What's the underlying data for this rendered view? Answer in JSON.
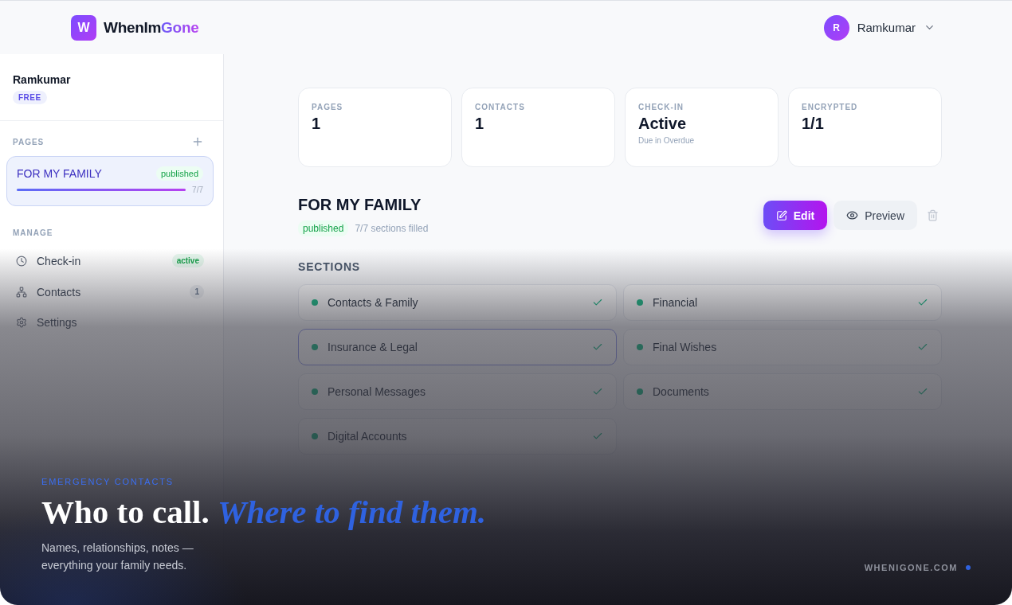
{
  "header": {
    "logo_mark": "W",
    "logo_text": "WhenIm",
    "logo_accent": "Gone",
    "user": {
      "initial": "R",
      "name": "Ramkumar"
    }
  },
  "sidebar": {
    "profile": {
      "name": "Ramkumar",
      "plan": "FREE"
    },
    "pages_heading": "PAGES",
    "pages": [
      {
        "title": "FOR MY FAMILY",
        "status": "published",
        "progress": "7/7",
        "level": 1,
        "selected": true
      }
    ],
    "manage_heading": "MANAGE",
    "manage_items": [
      {
        "kind": "checkin",
        "label": "Check-in",
        "badge": "active"
      },
      {
        "kind": "contacts",
        "label": "Contacts",
        "badge": "1"
      },
      {
        "kind": "settings",
        "label": "Settings"
      }
    ]
  },
  "stats": [
    {
      "label": "PAGES",
      "value": "1"
    },
    {
      "label": "CONTACTS",
      "value": "1"
    },
    {
      "label": "CHECK-IN",
      "value": "Active",
      "note": "Due in Overdue"
    },
    {
      "label": "ENCRYPTED",
      "value": "1/1"
    }
  ],
  "page": {
    "title": "FOR MY FAMILY",
    "status": "published",
    "progress_text": "7/7 sections filled",
    "edit": "Edit",
    "preview": "Preview"
  },
  "sections_heading": "SECTIONS",
  "sections": [
    {
      "name": "Contacts & Family",
      "done": true,
      "selected": false
    },
    {
      "name": "Financial",
      "done": true,
      "selected": false
    },
    {
      "name": "Insurance & Legal",
      "done": true,
      "selected": true
    },
    {
      "name": "Final Wishes",
      "done": true,
      "selected": false
    },
    {
      "name": "Personal Messages",
      "done": true,
      "selected": false
    },
    {
      "name": "Documents",
      "done": true,
      "selected": false
    },
    {
      "name": "Digital Accounts",
      "done": true,
      "selected": false
    }
  ],
  "promo": {
    "eyebrow": "EMERGENCY CONTACTS",
    "headline": "Who to call. *Where to find them.*",
    "body": "Names, relationships, notes — everything your family needs.",
    "site": "WHENIGONE.COM"
  }
}
